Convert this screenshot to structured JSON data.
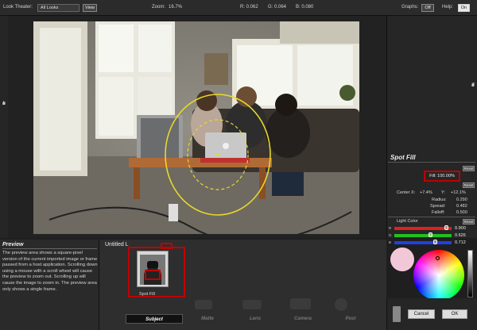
{
  "topbar": {
    "look_theater_label": "Look Theater:",
    "look_theater_value": "All Looks",
    "view_button": "View",
    "zoom_label": "Zoom:",
    "zoom_value": "16.7%",
    "r_readout": "R: 0.062",
    "g_readout": "G: 0.064",
    "b_readout": "B: 0.080",
    "graphs_label": "Graphs:",
    "graphs_value": "Off",
    "help_label": "Help:",
    "help_value": "On"
  },
  "side_labels": {
    "left": [
      "L",
      "o",
      "o",
      "k",
      "s"
    ],
    "right": [
      "T",
      "o",
      "o",
      "l",
      "s"
    ]
  },
  "tool": {
    "title": "Spot Fill",
    "reset_label": "Reset",
    "fill_text": "Fill: 100.00%",
    "center_x_label": "Center X:",
    "center_x_value": "+7.4%",
    "center_y_label": "Y:",
    "center_y_value": "+12.1%",
    "radius_label": "Radius:",
    "radius_value": "0.290",
    "spread_label": "Spread:",
    "spread_value": "0.482",
    "falloff_label": "Falloff:",
    "falloff_value": "0.500",
    "light_color_label": "Light Color",
    "channels": [
      {
        "letter": "R",
        "value": "0.900",
        "level": 0.9,
        "color": "#e02020"
      },
      {
        "letter": "G",
        "value": "0.626",
        "level": 0.626,
        "color": "#20c020"
      },
      {
        "letter": "B",
        "value": "0.712",
        "level": 0.712,
        "color": "#2040e0"
      }
    ],
    "swatch_color": "#f2c8d8"
  },
  "preview": {
    "title": "Preview",
    "description": "The preview area shows a square-pixel version of the current imported image or frame passed from a host application. Scrolling down using a mouse with a scroll wheel will cause the preview to zoom out. Scrolling up will cause the image to zoom in. The preview area only shows a single frame."
  },
  "look": {
    "name": "Untitled L",
    "tool_caption": "Spot Fill"
  },
  "tabs": [
    "Subject",
    "Matte",
    "Lens",
    "Camera",
    "Post"
  ],
  "dialog": {
    "cancel": "Cancel",
    "ok": "OK"
  },
  "colors": {
    "highlight_red": "#c00000",
    "ellipse": "#e8d82a"
  }
}
